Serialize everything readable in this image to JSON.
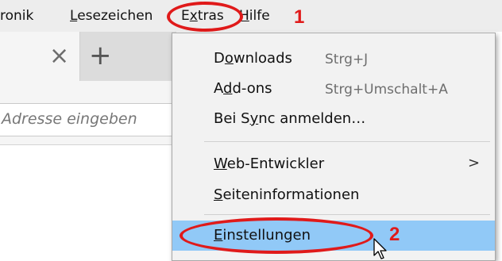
{
  "menubar": {
    "items": [
      {
        "label": "ronik"
      },
      {
        "pre": "",
        "ul": "L",
        "post": "esezeichen"
      },
      {
        "pre": "E",
        "ul": "x",
        "post": "tras"
      },
      {
        "pre": "",
        "ul": "H",
        "post": "ilfe"
      }
    ]
  },
  "annotations": {
    "step1": "1",
    "step2": "2"
  },
  "tab": {
    "close_icon": "close-icon",
    "newtab_icon": "plus-icon"
  },
  "urlbar": {
    "placeholder": "Adresse eingeben"
  },
  "menu": {
    "items": [
      {
        "pre": "D",
        "ul": "o",
        "post": "wnloads",
        "shortcut": "Strg+J"
      },
      {
        "pre": "A",
        "ul": "d",
        "post": "d-ons",
        "shortcut": "Strg+Umschalt+A"
      },
      {
        "pre": "Bei S",
        "ul": "y",
        "post": "nc anmelden…",
        "shortcut": ""
      },
      {
        "pre": "",
        "ul": "W",
        "post": "eb-Entwickler",
        "shortcut": "",
        "submenu": true
      },
      {
        "pre": "",
        "ul": "S",
        "post": "eiteninformationen",
        "shortcut": ""
      },
      {
        "pre": "",
        "ul": "E",
        "post": "instellungen",
        "shortcut": "",
        "selected": true
      }
    ],
    "submenu_arrow": ">"
  },
  "colors": {
    "annotation": "#e01a1a",
    "selection": "#91c9f7",
    "menu_bg": "#f2f2f2"
  }
}
